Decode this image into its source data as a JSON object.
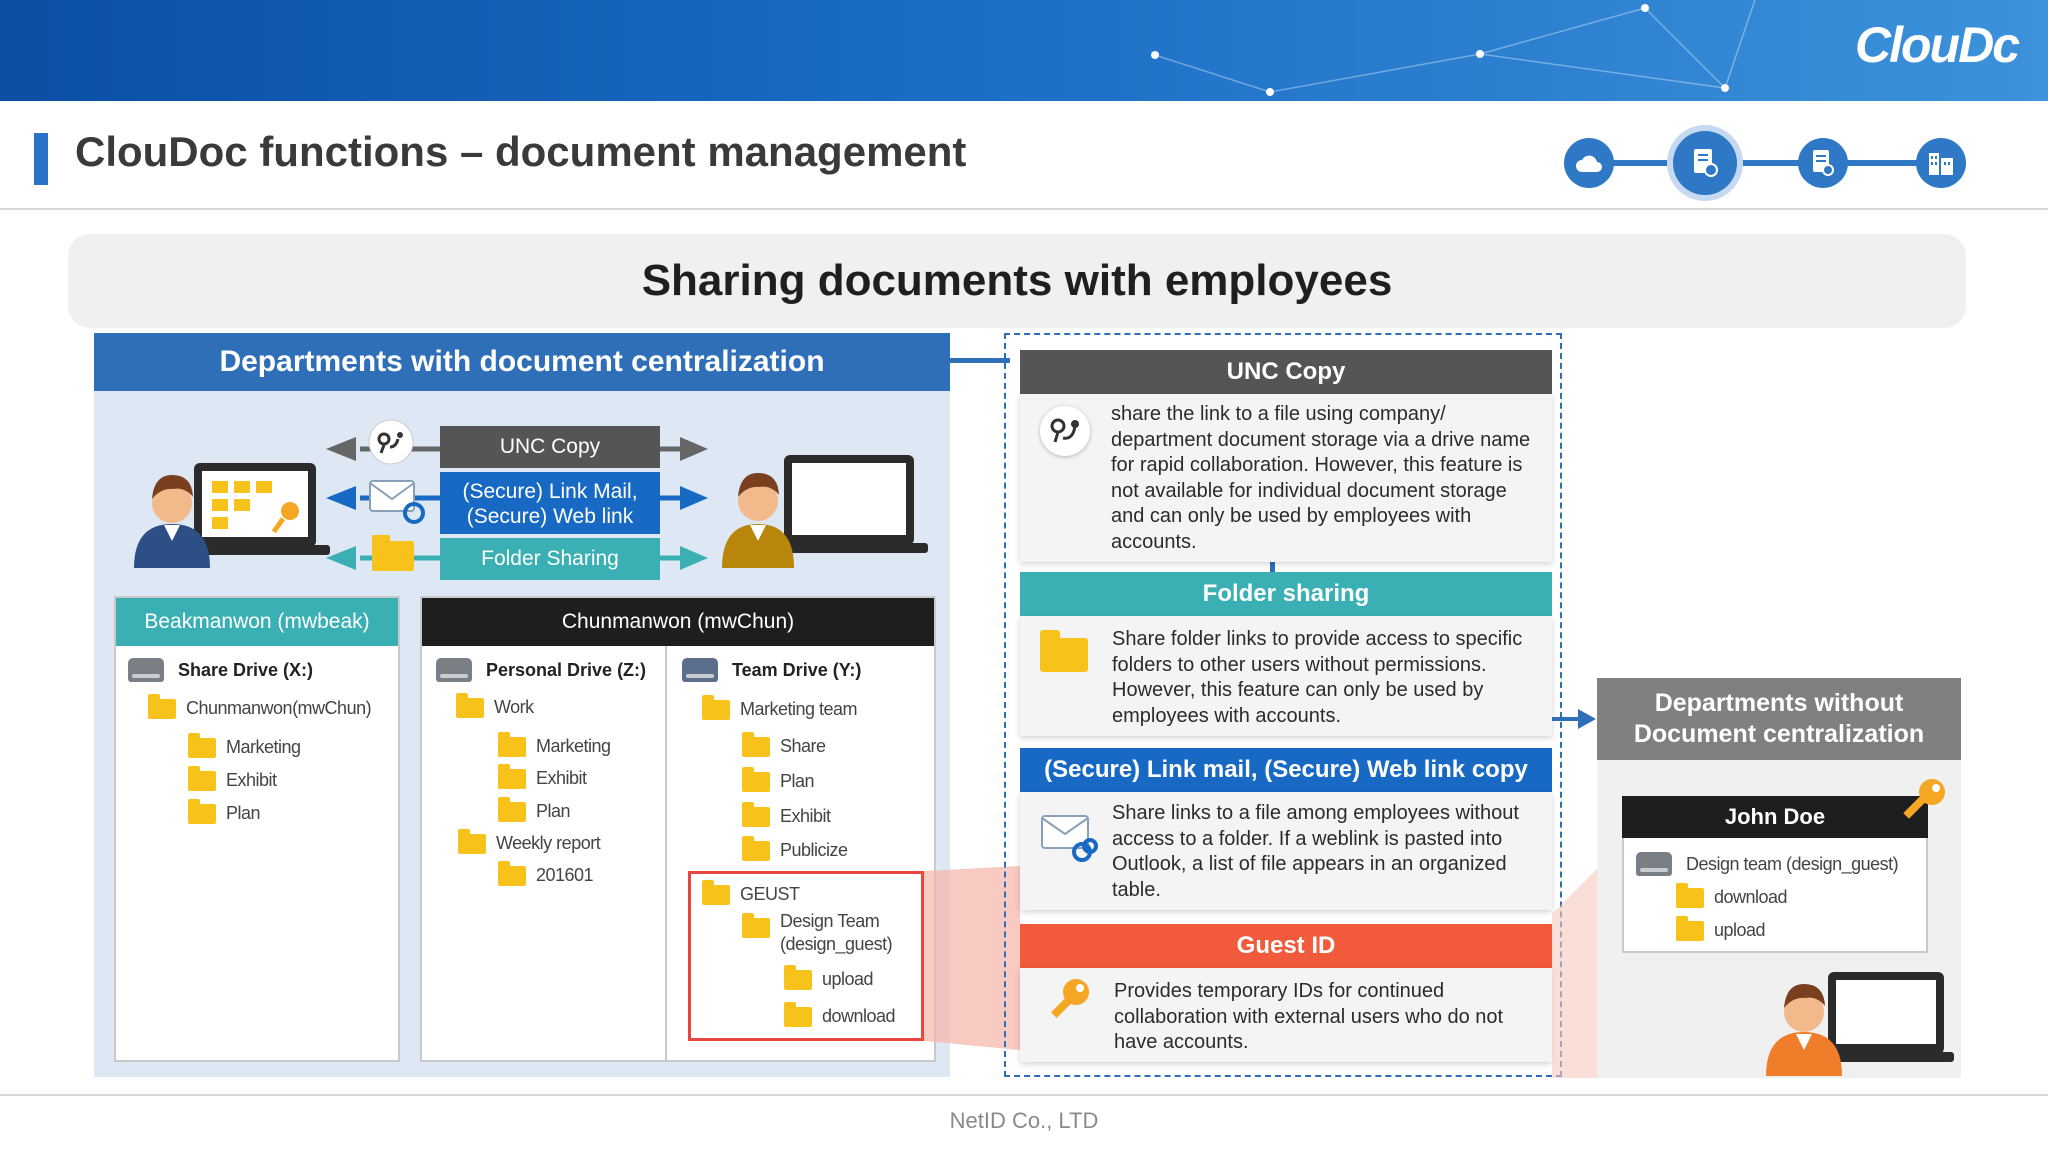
{
  "brand": {
    "logo_text": "ClouDc"
  },
  "header": {
    "title": "ClouDoc functions – document management"
  },
  "progress": {
    "step_icons": [
      "cloud-icon",
      "document-settings-icon",
      "document-gear-icon",
      "building-icon"
    ],
    "active_index": 1
  },
  "subtitle": "Sharing documents with employees",
  "left": {
    "header": "Departments with document centralization",
    "methods": {
      "unc": "UNC Copy",
      "link_line1": "(Secure) Link Mail,",
      "link_line2": "(Secure) Web link",
      "folder": "Folder Sharing"
    },
    "user1": {
      "name": "Beakmanwon (mwbeak)",
      "drive": "Share Drive (X:)",
      "items": [
        "Chunmanwon(mwChun)",
        "Marketing",
        "Exhibit",
        "Plan"
      ]
    },
    "user2": {
      "name": "Chunmanwon (mwChun)",
      "personal_drive": "Personal Drive (Z:)",
      "personal_items": [
        "Work",
        "Marketing",
        "Exhibit",
        "Plan",
        "Weekly report",
        "201601"
      ],
      "team_drive": "Team Drive (Y:)",
      "team_items": [
        "Marketing team",
        "Share",
        "Plan",
        "Exhibit",
        "Publicize"
      ],
      "guest_items": [
        "GEUST",
        "Design Team",
        "(design_guest)",
        "upload",
        "download"
      ]
    }
  },
  "middle": {
    "unc": {
      "title": "UNC Copy",
      "text": "share the link to a file using company/ department document storage via a drive name for rapid collaboration. However, this feature is not available for individual document storage and can only be used by employees with accounts."
    },
    "folder": {
      "title": "Folder sharing",
      "text": "Share folder links to provide access to specific folders to other users without permissions. However, this feature can only be used by employees with accounts."
    },
    "link": {
      "title": "(Secure) Link mail, (Secure) Web link copy",
      "text": "Share links to a file among employees without access to a folder. If a weblink is pasted into Outlook, a list of file appears in an organized table."
    },
    "guest": {
      "title": "Guest ID",
      "text": "Provides temporary IDs for continued collaboration with external users who do not have accounts."
    }
  },
  "right": {
    "header_line1": "Departments without",
    "header_line2": "Document centralization",
    "user": "John Doe",
    "drive": "Design team (design_guest)",
    "items": [
      "download",
      "upload"
    ]
  },
  "footer": "NetID Co., LTD",
  "colors": {
    "primary": "#2f6fb7",
    "teal": "#3bb0b4",
    "link_blue": "#1769c4",
    "guest_orange": "#f15a3a",
    "dark": "#555555",
    "folder": "#f7c31a"
  }
}
